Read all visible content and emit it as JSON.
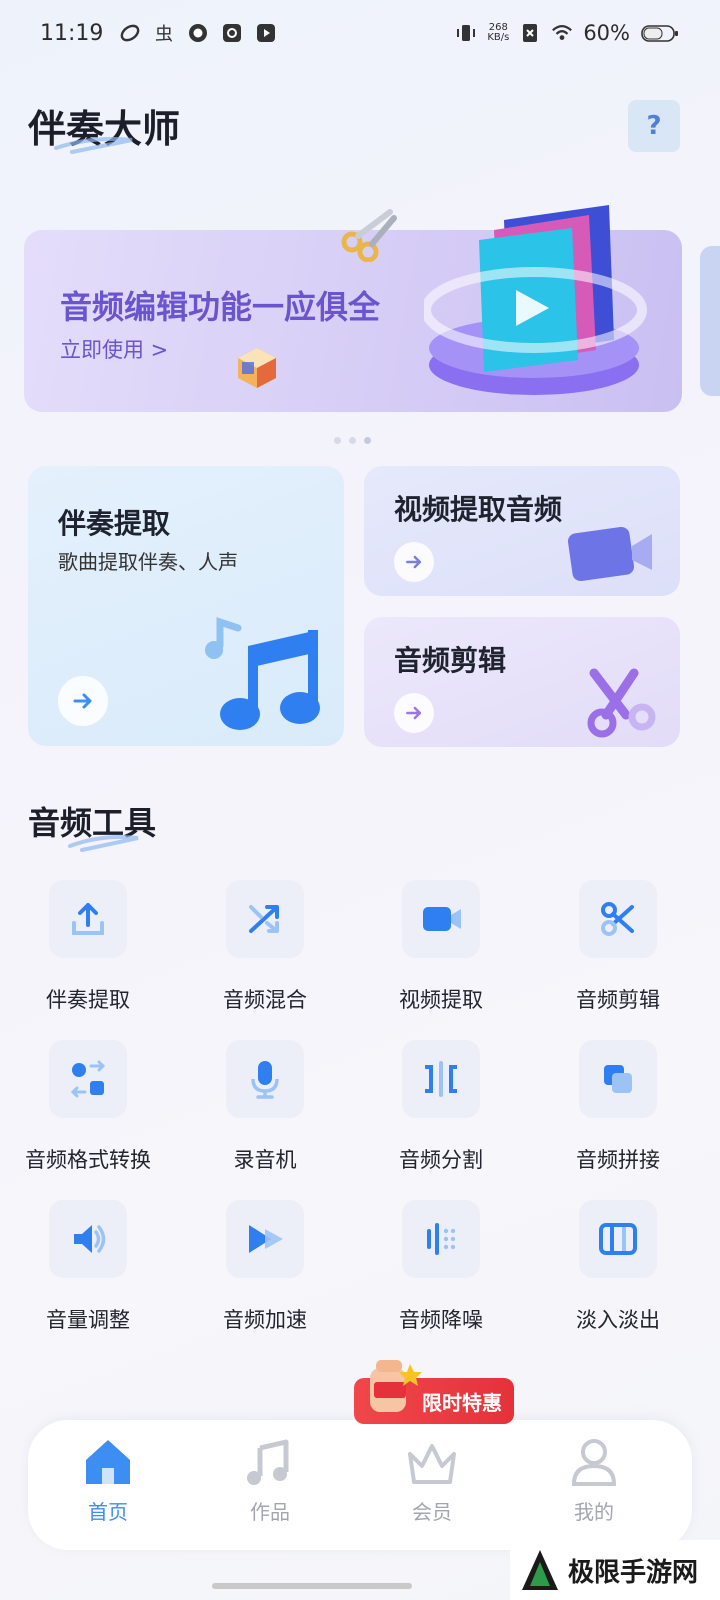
{
  "status_bar": {
    "time": "11:19",
    "net_speed_value": "268",
    "net_speed_unit": "KB/s",
    "battery": "60%"
  },
  "header": {
    "title": "伴奏大师",
    "help": "?"
  },
  "banner": {
    "title": "音频编辑功能一应俱全",
    "link": "立即使用 >"
  },
  "feature_cards": {
    "accompaniment": {
      "title": "伴奏提取",
      "subtitle": "歌曲提取伴奏、人声"
    },
    "video_extract": {
      "title": "视频提取音频"
    },
    "audio_edit": {
      "title": "音频剪辑"
    }
  },
  "tools_section": {
    "title": "音频工具",
    "items": [
      {
        "label": "伴奏提取",
        "icon": "upload-icon"
      },
      {
        "label": "音频混合",
        "icon": "shuffle-icon"
      },
      {
        "label": "视频提取",
        "icon": "video-camera-icon"
      },
      {
        "label": "音频剪辑",
        "icon": "scissors-icon"
      },
      {
        "label": "音频格式转换",
        "icon": "format-convert-icon"
      },
      {
        "label": "录音机",
        "icon": "microphone-icon"
      },
      {
        "label": "音频分割",
        "icon": "split-icon"
      },
      {
        "label": "音频拼接",
        "icon": "merge-icon"
      },
      {
        "label": "音量调整",
        "icon": "volume-icon"
      },
      {
        "label": "音频加速",
        "icon": "fast-forward-icon"
      },
      {
        "label": "音频降噪",
        "icon": "noise-reduction-icon"
      },
      {
        "label": "淡入淡出",
        "icon": "fade-icon"
      }
    ]
  },
  "promo": {
    "label": "限时特惠"
  },
  "bottom_nav": {
    "items": [
      {
        "label": "首页",
        "icon": "home-icon",
        "active": true
      },
      {
        "label": "作品",
        "icon": "music-note-icon",
        "active": false
      },
      {
        "label": "会员",
        "icon": "crown-icon",
        "active": false
      },
      {
        "label": "我的",
        "icon": "user-icon",
        "active": false
      }
    ]
  },
  "watermark": {
    "text": "极限手游网"
  },
  "colors": {
    "accent_blue": "#3d8ef2",
    "banner_purple": "#6a55cf",
    "promo_red": "#e5323a",
    "icon_blue": "#2f7ff0"
  }
}
